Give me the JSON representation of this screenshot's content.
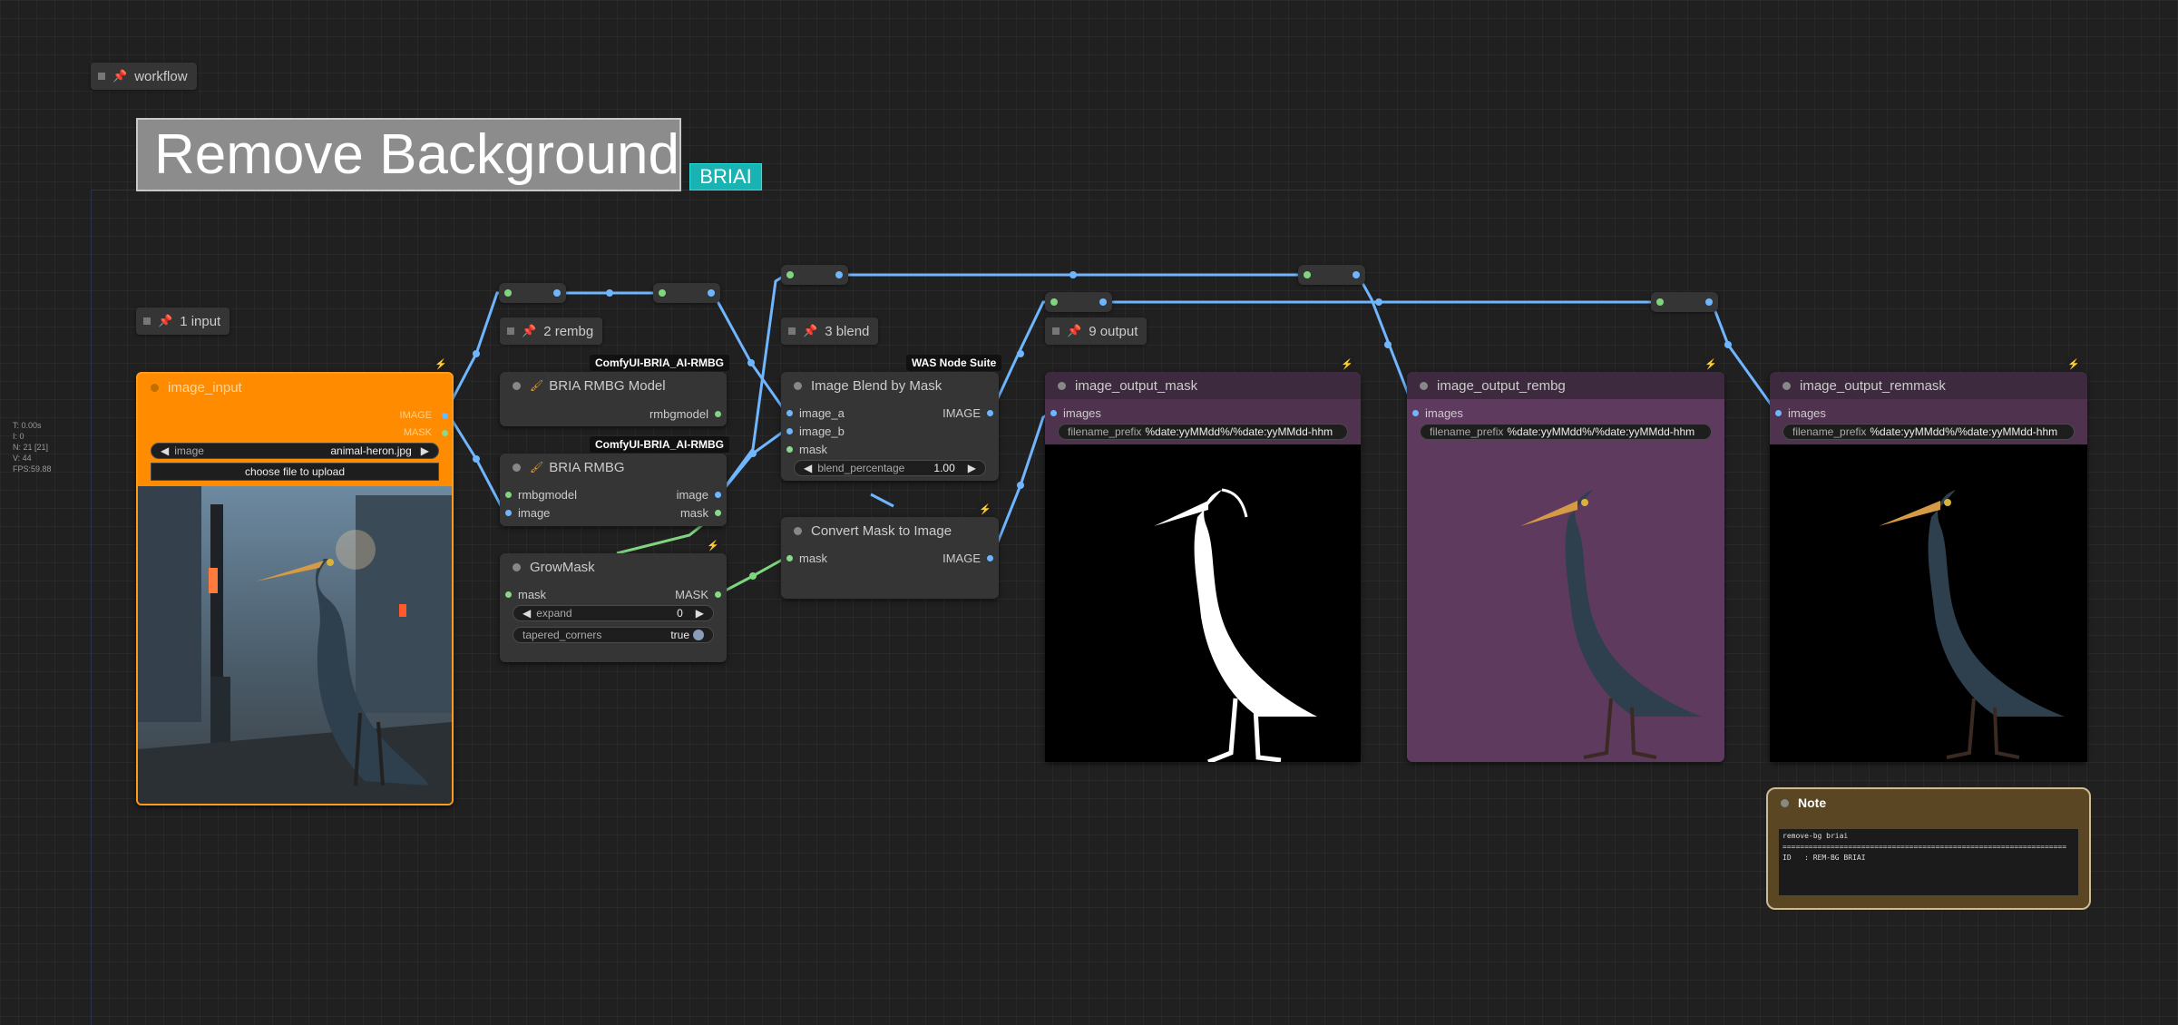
{
  "stats": [
    "T: 0.00s",
    "I: 0",
    "N: 21 [21]",
    "V: 44",
    "FPS:59.88"
  ],
  "groups": {
    "workflow": "workflow",
    "input": "1 input",
    "rembg": "2 rembg",
    "blend": "3 blend",
    "output": "9 output"
  },
  "title": "Remove Background",
  "briai_label": "BRIAI",
  "image_input": {
    "title": "image_input",
    "out_image": "IMAGE",
    "out_mask": "MASK",
    "image_label": "image",
    "image_value": "animal-heron.jpg",
    "upload_button": "choose file to upload"
  },
  "bria_model": {
    "badge": "ComfyUI-BRIA_AI-RMBG",
    "title": "BRIA RMBG Model",
    "out": "rmbgmodel"
  },
  "bria_rmbg": {
    "badge": "ComfyUI-BRIA_AI-RMBG",
    "title": "BRIA RMBG",
    "in_model": "rmbgmodel",
    "in_image": "image",
    "out_image": "image",
    "out_mask": "mask"
  },
  "growmask": {
    "title": "GrowMask",
    "in_mask": "mask",
    "out_mask": "MASK",
    "expand_label": "expand",
    "expand_value": "0",
    "tapered_label": "tapered_corners",
    "tapered_value": "true"
  },
  "blend": {
    "badge": "WAS Node Suite",
    "title": "Image Blend by Mask",
    "in_a": "image_a",
    "in_b": "image_b",
    "in_mask": "mask",
    "out": "IMAGE",
    "pct_label": "blend_percentage",
    "pct_value": "1.00"
  },
  "convert": {
    "title": "Convert Mask to Image",
    "in_mask": "mask",
    "out": "IMAGE"
  },
  "outputs": [
    {
      "title": "image_output_mask",
      "in": "images",
      "prefix_label": "filename_prefix",
      "prefix_value": "%date:yyMMdd%/%date:yyMMdd-hhm"
    },
    {
      "title": "image_output_rembg",
      "in": "images",
      "prefix_label": "filename_prefix",
      "prefix_value": "%date:yyMMdd%/%date:yyMMdd-hhm"
    },
    {
      "title": "image_output_remmask",
      "in": "images",
      "prefix_label": "filename_prefix",
      "prefix_value": "%date:yyMMdd%/%date:yyMMdd-hhm"
    }
  ],
  "note": {
    "title": "Note",
    "text": "remove-bg briai\n=================================================================\nID   : REM-BG BRIAI"
  },
  "colors": {
    "canvas": "#202020",
    "node": "#353535",
    "input_node": "#ff8c00",
    "output_node": "#3e2a3e",
    "link_image": "#6fb6ff",
    "link_mask": "#7fd67f",
    "briai": "#19b3b3"
  }
}
